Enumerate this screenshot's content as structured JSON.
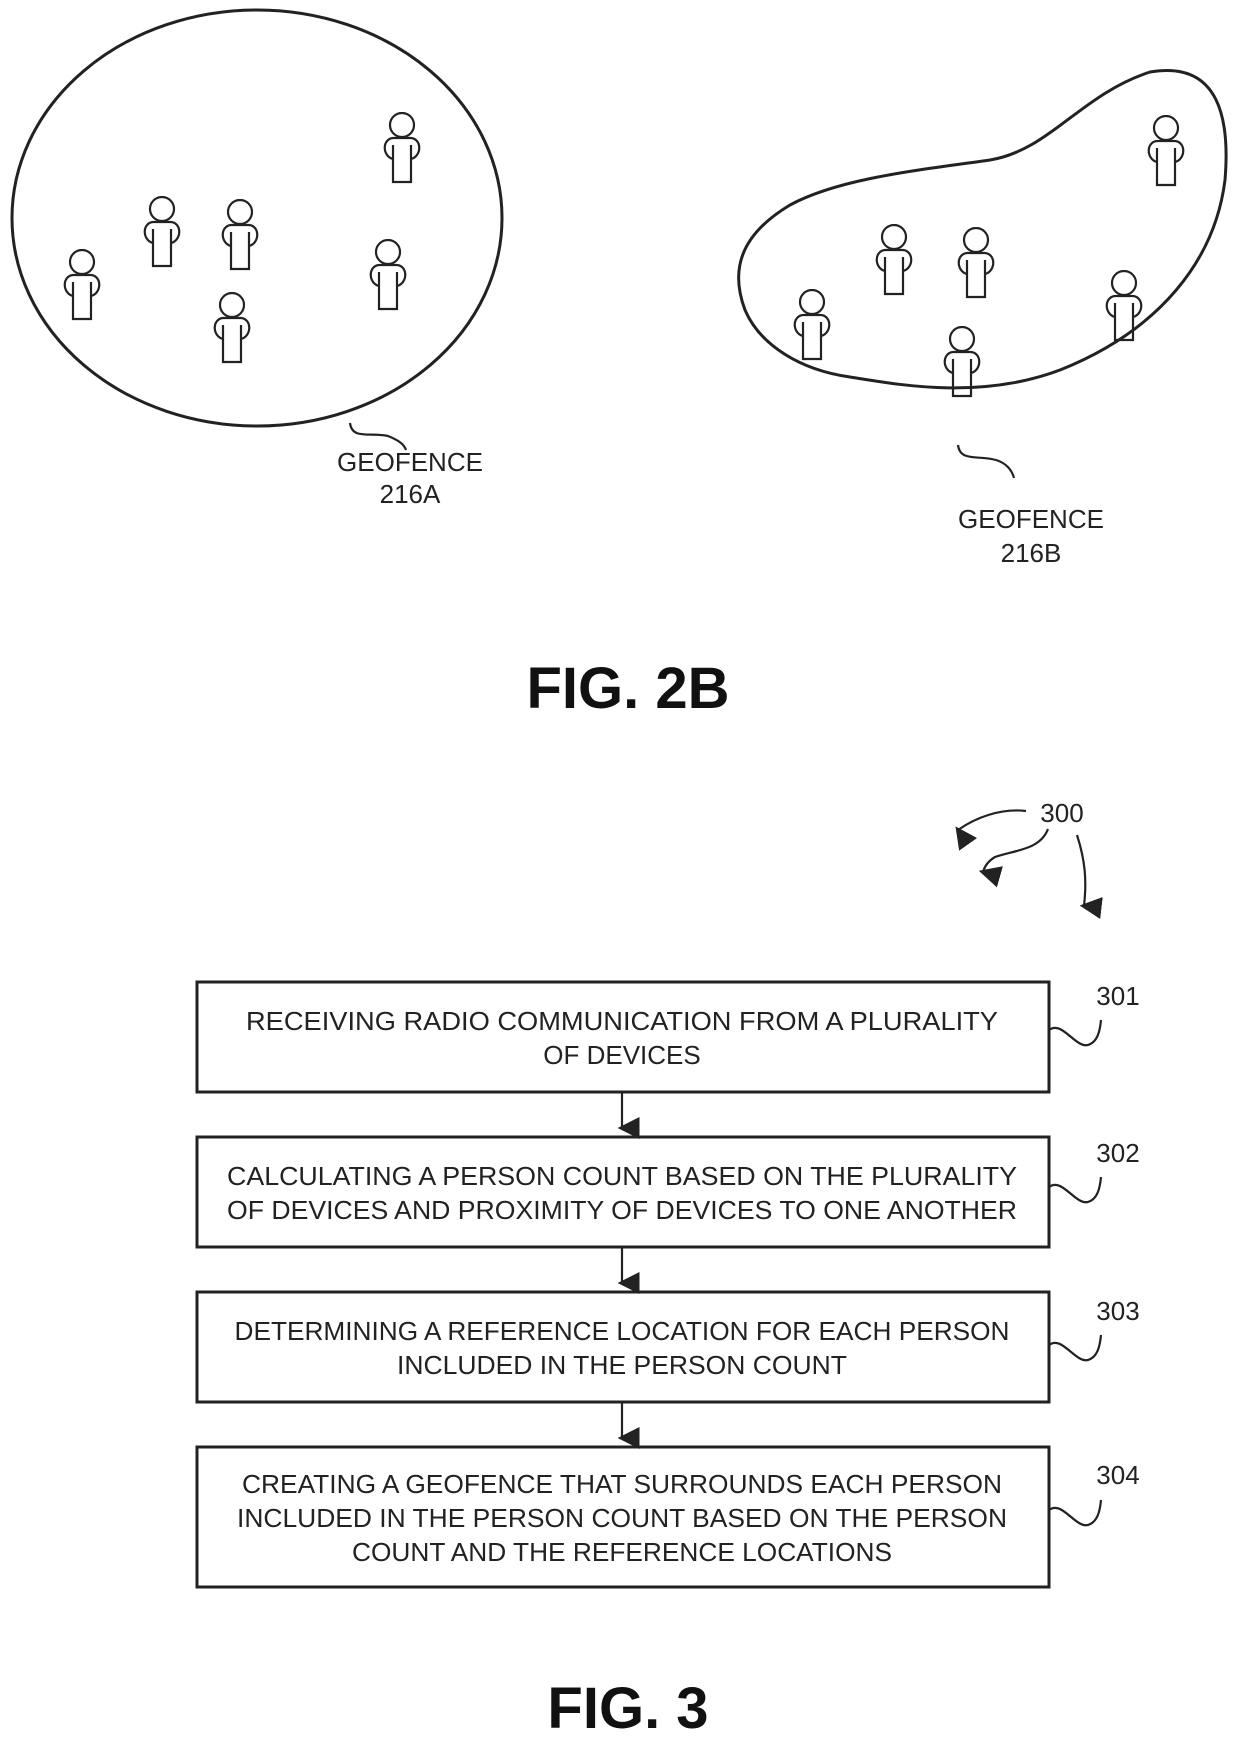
{
  "fig2b": {
    "caption": "FIG. 2B",
    "geofences": [
      {
        "label_line1": "GEOFENCE",
        "label_line2": "216A",
        "shape": "circle",
        "person_count": 6
      },
      {
        "label_line1": "GEOFENCE",
        "label_line2": "216B",
        "shape": "freeform",
        "person_count": 6
      }
    ]
  },
  "fig3": {
    "caption": "FIG. 3",
    "reference": "300",
    "steps": [
      {
        "ref": "301",
        "lines": [
          "RECEIVING RADIO COMMUNICATION FROM A PLURALITY",
          "OF DEVICES"
        ]
      },
      {
        "ref": "302",
        "lines": [
          "CALCULATING A PERSON COUNT BASED ON THE PLURALITY",
          "OF DEVICES AND PROXIMITY OF DEVICES TO ONE ANOTHER"
        ]
      },
      {
        "ref": "303",
        "lines": [
          "DETERMINING A REFERENCE LOCATION FOR EACH PERSON",
          "INCLUDED IN THE PERSON COUNT"
        ]
      },
      {
        "ref": "304",
        "lines": [
          "CREATING A GEOFENCE THAT SURROUNDS EACH PERSON",
          "INCLUDED IN THE PERSON COUNT BASED ON THE PERSON",
          "COUNT AND THE REFERENCE LOCATIONS"
        ]
      }
    ]
  }
}
